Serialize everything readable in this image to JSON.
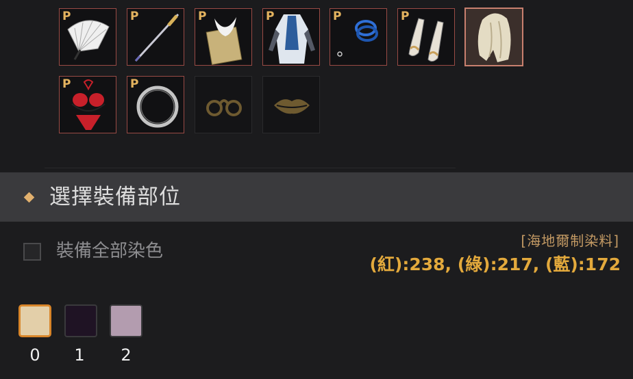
{
  "equipment": {
    "badge": "P",
    "slots": [
      {
        "name": "fan-icon"
      },
      {
        "name": "spear-icon"
      },
      {
        "name": "book-icon"
      },
      {
        "name": "outfit-icon"
      },
      {
        "name": "bracelet-icon"
      },
      {
        "name": "shoes-icon"
      },
      {
        "name": "hair-icon"
      },
      {
        "name": "underwear-icon"
      },
      {
        "name": "ring-icon"
      },
      {
        "name": "glasses-icon"
      },
      {
        "name": "lips-icon"
      }
    ]
  },
  "section": {
    "title": "選擇裝備部位"
  },
  "dye_all": {
    "label": "裝備全部染色",
    "checked": false
  },
  "dye": {
    "name": "[海地爾制染料]",
    "values_text": "(紅):238, (綠):217, (藍):172"
  },
  "swatches": [
    {
      "label": "0",
      "color": "#e3cfa9",
      "selected": true
    },
    {
      "label": "1",
      "color": "#1f1324",
      "selected": false
    },
    {
      "label": "2",
      "color": "#b39caf",
      "selected": false
    }
  ]
}
